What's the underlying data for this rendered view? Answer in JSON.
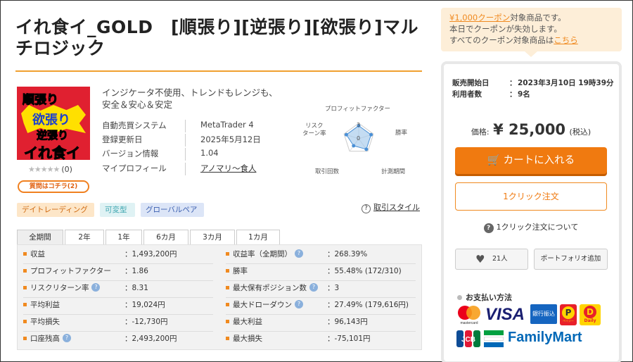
{
  "product": {
    "title": "イれ食イ_GOLD　[順張り][逆張り][欲張り]マルチロジック",
    "thumbnail_text": [
      "順張り",
      "欲張り",
      "逆張り",
      "イれ食イ"
    ],
    "rating_stars": "★★★★★",
    "rating_count": "(0)",
    "ask_button": "質問はコチラ(2)",
    "description": "インジケータ不使用、トレンドもレンジも、安全＆安心＆安定",
    "specs": [
      {
        "key": "自動売買システム",
        "value": "MetaTrader 4"
      },
      {
        "key": "登録更新日",
        "value": "2025年5月12日"
      },
      {
        "key": "バージョン情報",
        "value": "1.04"
      },
      {
        "key": "マイプロフィール",
        "value": "アノマリ〜食人"
      }
    ],
    "radar": {
      "labels": [
        "プロフィットファクター",
        "勝率",
        "計測期間",
        "取引回数",
        "リスク\nターン率"
      ],
      "levels": [
        3,
        0
      ],
      "values": [
        3,
        3,
        3,
        2,
        3
      ]
    },
    "tags": [
      "デイトレーディング",
      "可変型",
      "グローバルペア"
    ],
    "style_link": "取引スタイル",
    "tabs": [
      "全期間",
      "2年",
      "1年",
      "6カ月",
      "3カ月",
      "1カ月"
    ],
    "active_tab": "全期間",
    "stats_left": [
      {
        "label": "収益",
        "value": "1,493,200円",
        "info": false
      },
      {
        "label": "プロフィットファクター",
        "value": "1.86",
        "info": false
      },
      {
        "label": "リスクリターン率",
        "value": "8.31",
        "info": true
      },
      {
        "label": "平均利益",
        "value": "19,024円",
        "info": false
      },
      {
        "label": "平均損失",
        "value": "-12,730円",
        "info": false
      },
      {
        "label": "口座残高",
        "value": "2,493,200円",
        "info": true
      }
    ],
    "stats_right": [
      {
        "label": "収益率（全期間）",
        "value": "268.39%",
        "info": true
      },
      {
        "label": "勝率",
        "value": "55.48% (172/310)",
        "info": false
      },
      {
        "label": "最大保有ポジション数",
        "value": "3",
        "info": true
      },
      {
        "label": "最大ドローダウン",
        "value": "27.49% (179,616円)",
        "info": true
      },
      {
        "label": "最大利益",
        "value": "96,143円",
        "info": false
      },
      {
        "label": "最大損失",
        "value": "-75,101円",
        "info": false
      }
    ],
    "stat_separator": "："
  },
  "sidebar": {
    "coupon_line1_link": "¥1,000クーポン",
    "coupon_line1_rest": "対象商品です。",
    "coupon_line2": "本日でクーポンが失効します。",
    "coupon_line3_pre": "すべてのクーポン対象商品は",
    "coupon_line3_link": "こちら",
    "sale_start_label": "販売開始日",
    "sale_start_value": "2023年3月10日 19時39分",
    "users_label": "利用者数",
    "users_value": "9名",
    "colon": "：",
    "price_label": "価格:",
    "price_value": "¥ 25,000",
    "price_tax": "(税込)",
    "cart_button": "カートに入れる",
    "oneclick_button": "1クリック注文",
    "oneclick_about": "1クリック注文について",
    "favorite_count": "21人",
    "portfolio_button": "ポートフォリオ追加",
    "payment_title": "お支払い方法",
    "payment_logos": [
      "mastercard",
      "VISA",
      "銀行振込",
      "ペイジー",
      "Daily",
      "JCB",
      "FamilyMart"
    ]
  },
  "colors": {
    "accent": "#f07a10",
    "title_rule": "#f0a030",
    "thumb_bg": "#e02030"
  }
}
